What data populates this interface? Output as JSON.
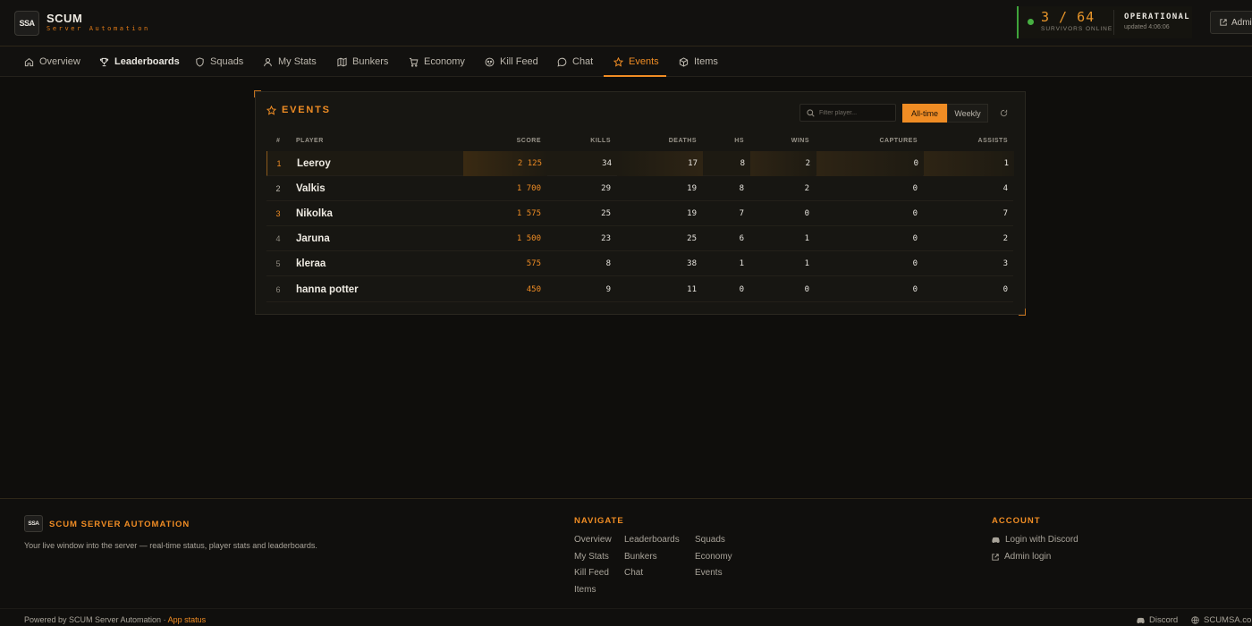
{
  "brand": {
    "logo": "SSA",
    "title": "SCUM",
    "subtitle": "Server Automation"
  },
  "status": {
    "count": "3 / 64",
    "label": "SURVIVORS ONLINE",
    "state": "OPERATIONAL",
    "updated": "updated 4:06:06",
    "color": "#47b042"
  },
  "admin_label": "Admin",
  "nav": {
    "items": [
      {
        "label": "Overview",
        "icon": "home-icon"
      },
      {
        "label": "Leaderboards",
        "icon": "trophy-icon"
      },
      {
        "label": "Squads",
        "icon": "shield-icon"
      },
      {
        "label": "My Stats",
        "icon": "user-icon"
      },
      {
        "label": "Bunkers",
        "icon": "map-icon"
      },
      {
        "label": "Economy",
        "icon": "cart-icon"
      },
      {
        "label": "Kill Feed",
        "icon": "skull-icon"
      },
      {
        "label": "Chat",
        "icon": "chat-icon"
      },
      {
        "label": "Events",
        "icon": "star-icon",
        "active": true
      },
      {
        "label": "Items",
        "icon": "package-icon"
      }
    ]
  },
  "card": {
    "title": "EVENTS",
    "filter_placeholder": "Filter player...",
    "range_options": [
      "All-time",
      "Weekly"
    ],
    "selected_range": "All-time"
  },
  "table": {
    "headers": [
      "#",
      "PLAYER",
      "SCORE",
      "KILLS",
      "DEATHS",
      "HS",
      "WINS",
      "CAPTURES",
      "ASSISTS"
    ],
    "rows": [
      {
        "rank": "1",
        "player": "Leeroy",
        "score": "2 125",
        "kills": "34",
        "deaths": "17",
        "hs": "8",
        "wins": "2",
        "captures": "0",
        "assists": "1"
      },
      {
        "rank": "2",
        "player": "Valkis",
        "score": "1 700",
        "kills": "29",
        "deaths": "19",
        "hs": "8",
        "wins": "2",
        "captures": "0",
        "assists": "4"
      },
      {
        "rank": "3",
        "player": "Nikolka",
        "score": "1 575",
        "kills": "25",
        "deaths": "19",
        "hs": "7",
        "wins": "0",
        "captures": "0",
        "assists": "7"
      },
      {
        "rank": "4",
        "player": "Jaruna",
        "score": "1 500",
        "kills": "23",
        "deaths": "25",
        "hs": "6",
        "wins": "1",
        "captures": "0",
        "assists": "2"
      },
      {
        "rank": "5",
        "player": "kleraa",
        "score": "575",
        "kills": "8",
        "deaths": "38",
        "hs": "1",
        "wins": "1",
        "captures": "0",
        "assists": "3"
      },
      {
        "rank": "6",
        "player": "hanna potter",
        "score": "450",
        "kills": "9",
        "deaths": "11",
        "hs": "0",
        "wins": "0",
        "captures": "0",
        "assists": "0"
      }
    ]
  },
  "footer": {
    "logo": "SSA",
    "brand": "SCUM SERVER AUTOMATION",
    "description": "Your live window into the server — real-time status, player stats and leaderboards.",
    "navigate_title": "NAVIGATE",
    "navigate_links": [
      "Overview",
      "Leaderboards",
      "Squads",
      "My Stats",
      "Bunkers",
      "Economy",
      "Kill Feed",
      "Chat",
      "Events",
      "Items"
    ],
    "account_title": "ACCOUNT",
    "account_links": [
      "Login with Discord",
      "Admin login"
    ],
    "powered_text": "Powered by SCUM Server Automation · ",
    "app_status": "App status",
    "discord": "Discord",
    "site": "SCUMSA.com"
  },
  "colors": {
    "accent": "#ef8c24",
    "background": "#0f0e0c",
    "online": "#47b042"
  }
}
